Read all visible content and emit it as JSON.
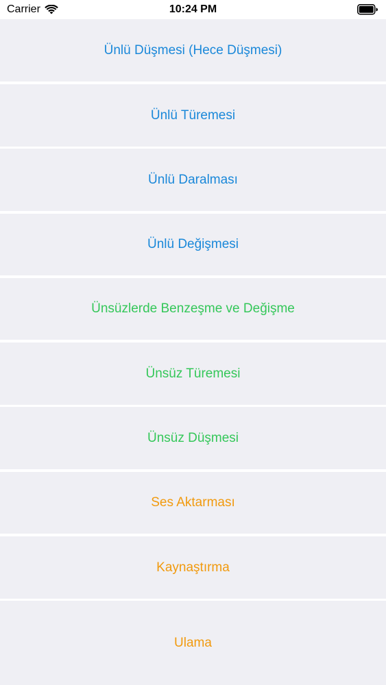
{
  "status_bar": {
    "carrier": "Carrier",
    "time": "10:24 PM",
    "wifi_icon": "wifi-icon",
    "battery_icon": "battery-icon"
  },
  "colors": {
    "row_background": "#efeff4",
    "blue": "#1a88d9",
    "green": "#34c759",
    "orange": "#f19a0e"
  },
  "menu": {
    "items": [
      {
        "label": "Ünlü Düşmesi (Hece Düşmesi)",
        "color": "blue"
      },
      {
        "label": "Ünlü Türemesi",
        "color": "blue"
      },
      {
        "label": "Ünlü Daralması",
        "color": "blue"
      },
      {
        "label": "Ünlü Değişmesi",
        "color": "blue"
      },
      {
        "label": "Ünsüzlerde Benzeşme ve Değişme",
        "color": "green"
      },
      {
        "label": "Ünsüz Türemesi",
        "color": "green"
      },
      {
        "label": "Ünsüz Düşmesi",
        "color": "green"
      },
      {
        "label": "Ses Aktarması",
        "color": "orange"
      },
      {
        "label": "Kaynaştırma",
        "color": "orange"
      },
      {
        "label": "Ulama",
        "color": "orange"
      }
    ]
  }
}
